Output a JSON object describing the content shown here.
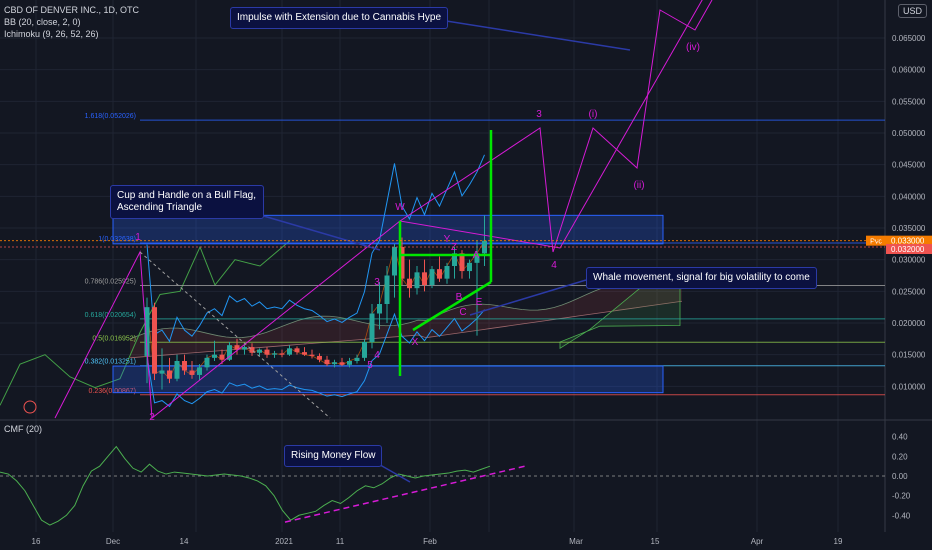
{
  "legend": {
    "symbol": "CBD OF DENVER INC., 1D, OTC",
    "bb": "BB (20, close, 2, 0)",
    "ichimoku": "Ichimoku (9, 26, 52, 26)",
    "cmf": "CMF (20)"
  },
  "currency": "USD",
  "callouts": {
    "impulse": "Impulse with Extension due to Cannabis Hype",
    "cup": "Cup and Handle on a Bull Flag, Ascending Triangle",
    "whale": "Whale movement, signal for big volatility to come",
    "money_flow": "Rising Money Flow"
  },
  "price_tags": {
    "pvc_label": "Pvc",
    "pvc": "0.033000",
    "last": "0.032000"
  },
  "colors": {
    "up": "#26a69a",
    "down": "#ef5350",
    "elliott": "#d61bd6",
    "flag": "#00e600",
    "fib": "#2962ff",
    "callout_bg": "#0b1140",
    "cmf_line": "#4caf50"
  },
  "chart_data": [
    {
      "type": "candlestick",
      "y_ticks": [
        "0.065000",
        "0.060000",
        "0.055000",
        "0.050000",
        "0.045000",
        "0.040000",
        "0.035000",
        "0.030000",
        "0.025000",
        "0.020000",
        "0.015000",
        "0.010000"
      ],
      "x_ticks": [
        "16",
        "Dec",
        "14",
        "2021",
        "11",
        "Feb",
        "15",
        "Mar",
        "Apr",
        "19"
      ],
      "ylim": [
        0.005,
        0.071
      ],
      "fib_levels": [
        {
          "label": "1.618(0.052026)",
          "value": 0.052026
        },
        {
          "label": "1(0.032638)",
          "value": 0.032638
        },
        {
          "label": "0.786(0.025925)",
          "value": 0.025925
        },
        {
          "label": "0.618(0.020654)",
          "value": 0.020654
        },
        {
          "label": "0.5(0.016952)",
          "value": 0.016952
        },
        {
          "label": "0.382(0.013251)",
          "value": 0.013251
        },
        {
          "label": "0.236(0.00867)",
          "value": 0.00867
        }
      ],
      "wave_labels": [
        "1",
        "2",
        "3",
        "4",
        "5",
        "W",
        "X",
        "Y",
        "Z",
        "A",
        "B",
        "C",
        "E",
        "3",
        "4",
        "(i)",
        "(ii)",
        "(iv)"
      ],
      "candles": [
        {
          "o": 0.0148,
          "h": 0.024,
          "l": 0.0105,
          "c": 0.0225
        },
        {
          "o": 0.0225,
          "h": 0.0232,
          "l": 0.011,
          "c": 0.012
        },
        {
          "o": 0.012,
          "h": 0.016,
          "l": 0.0095,
          "c": 0.0125
        },
        {
          "o": 0.0125,
          "h": 0.0145,
          "l": 0.0105,
          "c": 0.0112
        },
        {
          "o": 0.0112,
          "h": 0.015,
          "l": 0.0108,
          "c": 0.014
        },
        {
          "o": 0.014,
          "h": 0.015,
          "l": 0.0118,
          "c": 0.0125
        },
        {
          "o": 0.0125,
          "h": 0.014,
          "l": 0.0112,
          "c": 0.0118
        },
        {
          "o": 0.0118,
          "h": 0.0135,
          "l": 0.011,
          "c": 0.013
        },
        {
          "o": 0.013,
          "h": 0.015,
          "l": 0.0125,
          "c": 0.0145
        },
        {
          "o": 0.0145,
          "h": 0.0172,
          "l": 0.014,
          "c": 0.015
        },
        {
          "o": 0.015,
          "h": 0.0158,
          "l": 0.0135,
          "c": 0.0142
        },
        {
          "o": 0.0142,
          "h": 0.017,
          "l": 0.014,
          "c": 0.0165
        },
        {
          "o": 0.0165,
          "h": 0.0175,
          "l": 0.015,
          "c": 0.0158
        },
        {
          "o": 0.0158,
          "h": 0.0165,
          "l": 0.015,
          "c": 0.0162
        },
        {
          "o": 0.0162,
          "h": 0.0168,
          "l": 0.0148,
          "c": 0.0153
        },
        {
          "o": 0.0153,
          "h": 0.016,
          "l": 0.0148,
          "c": 0.0158
        },
        {
          "o": 0.0158,
          "h": 0.0162,
          "l": 0.0145,
          "c": 0.015
        },
        {
          "o": 0.015,
          "h": 0.0156,
          "l": 0.0145,
          "c": 0.0152
        },
        {
          "o": 0.0152,
          "h": 0.0158,
          "l": 0.0146,
          "c": 0.015
        },
        {
          "o": 0.015,
          "h": 0.0165,
          "l": 0.0148,
          "c": 0.016
        },
        {
          "o": 0.016,
          "h": 0.0163,
          "l": 0.015,
          "c": 0.0154
        },
        {
          "o": 0.0154,
          "h": 0.0162,
          "l": 0.0148,
          "c": 0.015
        },
        {
          "o": 0.015,
          "h": 0.0158,
          "l": 0.0144,
          "c": 0.0148
        },
        {
          "o": 0.0148,
          "h": 0.0152,
          "l": 0.0138,
          "c": 0.0142
        },
        {
          "o": 0.0142,
          "h": 0.0148,
          "l": 0.0132,
          "c": 0.0135
        },
        {
          "o": 0.0135,
          "h": 0.0142,
          "l": 0.013,
          "c": 0.0138
        },
        {
          "o": 0.0138,
          "h": 0.0145,
          "l": 0.0132,
          "c": 0.0134
        },
        {
          "o": 0.0134,
          "h": 0.0145,
          "l": 0.013,
          "c": 0.014
        },
        {
          "o": 0.014,
          "h": 0.015,
          "l": 0.0136,
          "c": 0.0145
        },
        {
          "o": 0.0145,
          "h": 0.0175,
          "l": 0.014,
          "c": 0.017
        },
        {
          "o": 0.017,
          "h": 0.023,
          "l": 0.016,
          "c": 0.0215
        },
        {
          "o": 0.0215,
          "h": 0.0265,
          "l": 0.019,
          "c": 0.023
        },
        {
          "o": 0.023,
          "h": 0.029,
          "l": 0.02,
          "c": 0.0275
        },
        {
          "o": 0.0275,
          "h": 0.0325,
          "l": 0.024,
          "c": 0.032
        },
        {
          "o": 0.032,
          "h": 0.0335,
          "l": 0.026,
          "c": 0.027
        },
        {
          "o": 0.027,
          "h": 0.03,
          "l": 0.024,
          "c": 0.0255
        },
        {
          "o": 0.0255,
          "h": 0.029,
          "l": 0.0245,
          "c": 0.028
        },
        {
          "o": 0.028,
          "h": 0.03,
          "l": 0.025,
          "c": 0.026
        },
        {
          "o": 0.026,
          "h": 0.029,
          "l": 0.0255,
          "c": 0.0285
        },
        {
          "o": 0.0285,
          "h": 0.0305,
          "l": 0.0265,
          "c": 0.027
        },
        {
          "o": 0.027,
          "h": 0.0295,
          "l": 0.0262,
          "c": 0.029
        },
        {
          "o": 0.029,
          "h": 0.032,
          "l": 0.027,
          "c": 0.031
        },
        {
          "o": 0.031,
          "h": 0.0315,
          "l": 0.027,
          "c": 0.0282
        },
        {
          "o": 0.0282,
          "h": 0.03,
          "l": 0.027,
          "c": 0.0295
        },
        {
          "o": 0.0295,
          "h": 0.033,
          "l": 0.018,
          "c": 0.031
        },
        {
          "o": 0.031,
          "h": 0.037,
          "l": 0.029,
          "c": 0.033
        }
      ]
    },
    {
      "type": "line",
      "name": "CMF (20)",
      "y_ticks": [
        "0.40",
        "0.20",
        "0.00",
        "-0.20",
        "-0.40"
      ],
      "ylim": [
        -0.55,
        0.55
      ],
      "values": [
        0.04,
        0.02,
        -0.05,
        -0.15,
        -0.3,
        -0.45,
        -0.5,
        -0.46,
        -0.4,
        -0.3,
        -0.1,
        0.05,
        0.1,
        0.2,
        0.3,
        0.18,
        0.08,
        0.04,
        0.12,
        0.05,
        0.02,
        0.04,
        0.03,
        0.02,
        0.01,
        0.0,
        0.01,
        0.02,
        0.01,
        0.0,
        -0.02,
        -0.05,
        -0.1,
        -0.2,
        -0.35,
        -0.45,
        -0.4,
        -0.38,
        -0.36,
        -0.3,
        -0.25,
        -0.28,
        -0.22,
        -0.15,
        -0.1,
        -0.12,
        -0.08,
        -0.02,
        0.02,
        0.0,
        -0.02,
        0.0,
        0.01,
        0.02,
        0.03,
        0.05,
        0.06,
        0.04,
        0.07,
        0.1
      ]
    }
  ]
}
